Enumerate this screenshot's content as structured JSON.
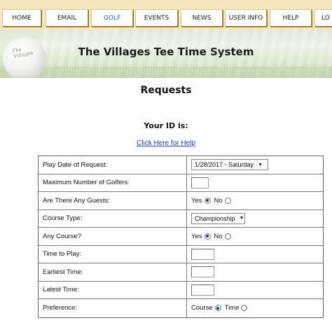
{
  "nav": {
    "items": [
      {
        "label": "HOME"
      },
      {
        "label": "EMAIL"
      },
      {
        "label": "GOLF"
      },
      {
        "label": "EVENTS"
      },
      {
        "label": "NEWS"
      },
      {
        "label": "USER INFO"
      },
      {
        "label": "HELP"
      },
      {
        "label": "LO"
      }
    ],
    "active": "GOLF"
  },
  "banner": {
    "title": "The Villages Tee Time System",
    "logo_text": "The Villages"
  },
  "page": {
    "title": "Requests",
    "your_id_label": "Your ID is:",
    "help_link": "Click Here for Help"
  },
  "form": {
    "play_date": {
      "label": "Play Date of Request:",
      "value": "1/28/2017 - Saturday"
    },
    "max_golfers": {
      "label": "Maximum Number of Golfers:",
      "value": ""
    },
    "guests": {
      "label": "Are There Any Guests:",
      "yes": "Yes",
      "no": "No",
      "selected": "No"
    },
    "course_type": {
      "label": "Course Type:",
      "value": "Championship"
    },
    "any_course": {
      "label": "Any Course?",
      "yes": "Yes",
      "no": "No",
      "selected": "No"
    },
    "time_to_play": {
      "label": "Time to Play:",
      "value": ""
    },
    "earliest_time": {
      "label": "Earliest Time:",
      "value": ""
    },
    "latest_time": {
      "label": "Latest Time:",
      "value": ""
    },
    "preference": {
      "label": "Preference:",
      "course": "Course",
      "time": "Time",
      "selected": "Course"
    }
  }
}
